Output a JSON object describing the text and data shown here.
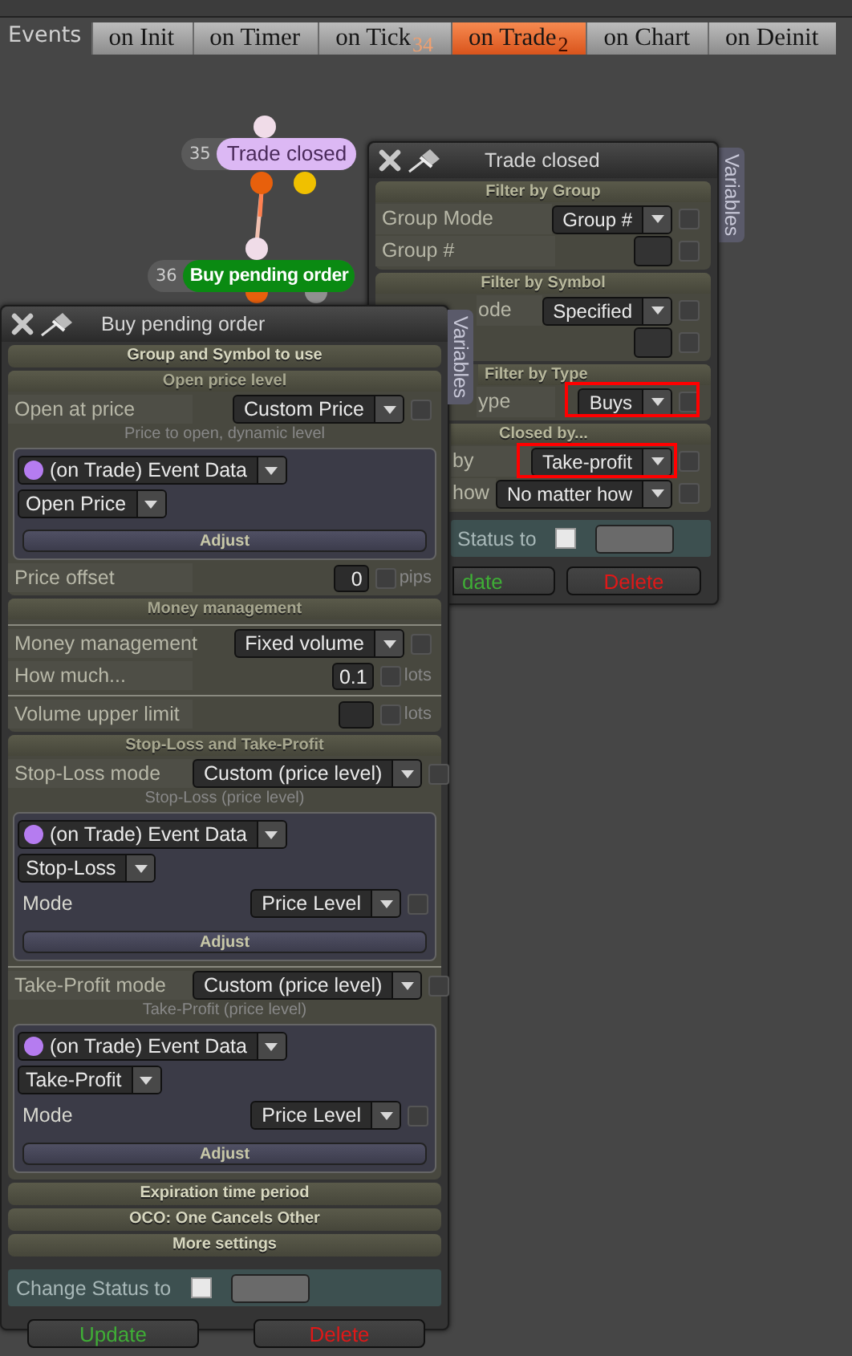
{
  "events_bar": {
    "label": "Events",
    "tabs": [
      {
        "label": "on Init",
        "selected": false
      },
      {
        "label": "on Timer",
        "selected": false
      },
      {
        "label": "on Tick",
        "selected": false,
        "badge": "34"
      },
      {
        "label": "on Trade",
        "selected": true,
        "badge": "2"
      },
      {
        "label": "on Chart",
        "selected": false
      },
      {
        "label": "on Deinit",
        "selected": false
      }
    ]
  },
  "nodes": [
    {
      "number": "35",
      "title": "Trade closed",
      "kind": "event"
    },
    {
      "number": "36",
      "title": "Buy pending order",
      "kind": "action"
    }
  ],
  "trade_closed_panel": {
    "title": "Trade closed",
    "side_tab": "Variables",
    "sections": [
      {
        "title": "Filter by Group",
        "rows": [
          {
            "kind": "select",
            "label": "Group Mode",
            "value": "Group #",
            "checked": false
          },
          {
            "kind": "input",
            "label": "Group #",
            "checked": false
          }
        ]
      },
      {
        "title": "Filter by Symbol",
        "rows": [
          {
            "kind": "select",
            "label": "ode",
            "value": "Specified",
            "checked": false
          },
          {
            "kind": "input",
            "checked": false
          }
        ]
      },
      {
        "title": "Filter by Type",
        "rows": [
          {
            "kind": "select",
            "label": "ype",
            "value": "Buys",
            "checked": false
          }
        ]
      },
      {
        "title": "Closed by...",
        "rows": [
          {
            "kind": "select",
            "label": "by",
            "value": "Take-profit",
            "checked": false
          },
          {
            "kind": "select",
            "label": "how",
            "value": "No matter how",
            "checked": false
          }
        ]
      }
    ],
    "status": {
      "label": "Status to",
      "checked": false
    },
    "buttons": [
      {
        "label": "date",
        "kind": "update"
      },
      {
        "label": "Delete",
        "kind": "delete"
      }
    ]
  },
  "buy_pending_panel": {
    "title": "Buy pending order",
    "side_tab": "Variables",
    "blocks": [
      {
        "kind": "collapsed",
        "title": "Group and Symbol to use"
      },
      {
        "kind": "section",
        "title": "Open price level",
        "items": [
          {
            "kind": "select",
            "label": "Open at price",
            "value": "Custom Price",
            "checked": false
          },
          {
            "kind": "caption",
            "text": "Price to open, dynamic level"
          },
          {
            "kind": "source",
            "source": "(on Trade) Event Data",
            "color": "#b57cf0",
            "field": "Open Price",
            "button": "Adjust"
          },
          {
            "kind": "number",
            "label": "Price offset",
            "value": "0",
            "checked": false,
            "unit": "pips"
          }
        ]
      },
      {
        "kind": "section",
        "title": "Money management",
        "items": [
          {
            "kind": "rule"
          },
          {
            "kind": "select",
            "label": "Money management",
            "value": "Fixed volume",
            "checked": false
          },
          {
            "kind": "number",
            "label": "How much...",
            "value": "0.1",
            "checked": false,
            "unit": "lots"
          },
          {
            "kind": "rule"
          },
          {
            "kind": "number",
            "label": "Volume upper limit",
            "checked": false,
            "unit": "lots"
          }
        ]
      },
      {
        "kind": "section",
        "title": "Stop-Loss and Take-Profit",
        "items": [
          {
            "kind": "select",
            "label": "Stop-Loss mode",
            "value": "Custom (price level)",
            "checked": false
          },
          {
            "kind": "caption",
            "text": "Stop-Loss (price level)"
          },
          {
            "kind": "source",
            "source": "(on Trade) Event Data",
            "color": "#b57cf0",
            "field": "Stop-Loss",
            "mode_label": "Mode",
            "mode": "Price Level",
            "mode_checked": false,
            "button": "Adjust"
          },
          {
            "kind": "rule"
          },
          {
            "kind": "select",
            "label": "Take-Profit mode",
            "value": "Custom (price level)",
            "checked": false
          },
          {
            "kind": "caption",
            "text": "Take-Profit (price level)"
          },
          {
            "kind": "source",
            "source": "(on Trade) Event Data",
            "color": "#b57cf0",
            "field": "Take-Profit",
            "mode_label": "Mode",
            "mode": "Price Level",
            "mode_checked": false,
            "button": "Adjust"
          }
        ]
      },
      {
        "kind": "collapsed",
        "title": "Expiration time period"
      },
      {
        "kind": "collapsed",
        "title": "OCO: One Cancels Other"
      },
      {
        "kind": "collapsed",
        "title": "More settings"
      }
    ],
    "status": {
      "label": "Change Status to",
      "checked": false
    },
    "buttons": [
      {
        "label": "Update",
        "kind": "update"
      },
      {
        "label": "Delete",
        "kind": "delete"
      }
    ]
  }
}
